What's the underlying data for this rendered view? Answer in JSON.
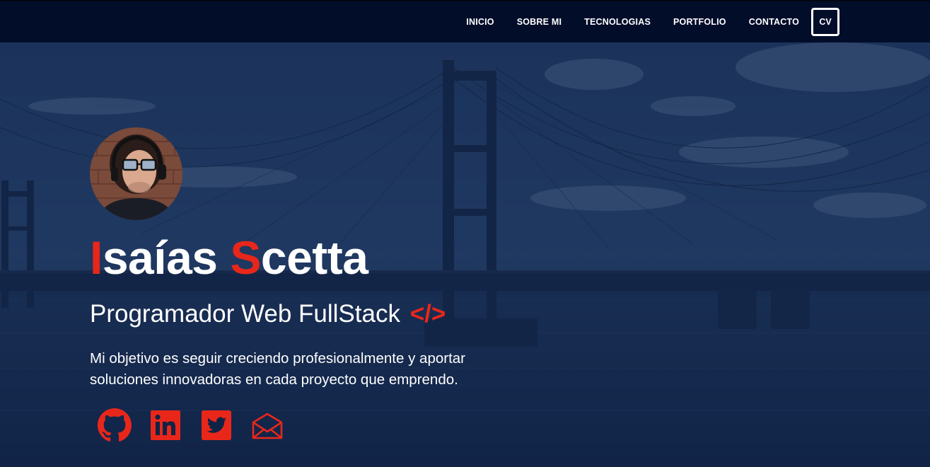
{
  "nav": {
    "items": [
      {
        "label": "INICIO"
      },
      {
        "label": "SOBRE MI"
      },
      {
        "label": "TECNOLOGIAS"
      },
      {
        "label": "PORTFOLIO"
      },
      {
        "label": "CONTACTO"
      }
    ],
    "cv_label": "CV"
  },
  "hero": {
    "name": {
      "first_initial": "I",
      "first_rest": "saías ",
      "last_initial": "S",
      "last_rest": "cetta"
    },
    "subtitle": "Programador Web FullStack",
    "code_symbol": "</>",
    "description": "Mi objetivo es seguir creciendo profesionalmente y aportar soluciones innovadoras en cada proyecto que emprendo."
  },
  "social": [
    {
      "icon": "github-icon"
    },
    {
      "icon": "linkedin-icon"
    },
    {
      "icon": "twitter-icon"
    },
    {
      "icon": "envelope-icon"
    }
  ],
  "colors": {
    "accent": "#e8271a",
    "navbar_bg": "#020d2a",
    "overlay": "#0f2347",
    "text": "#ffffff"
  }
}
